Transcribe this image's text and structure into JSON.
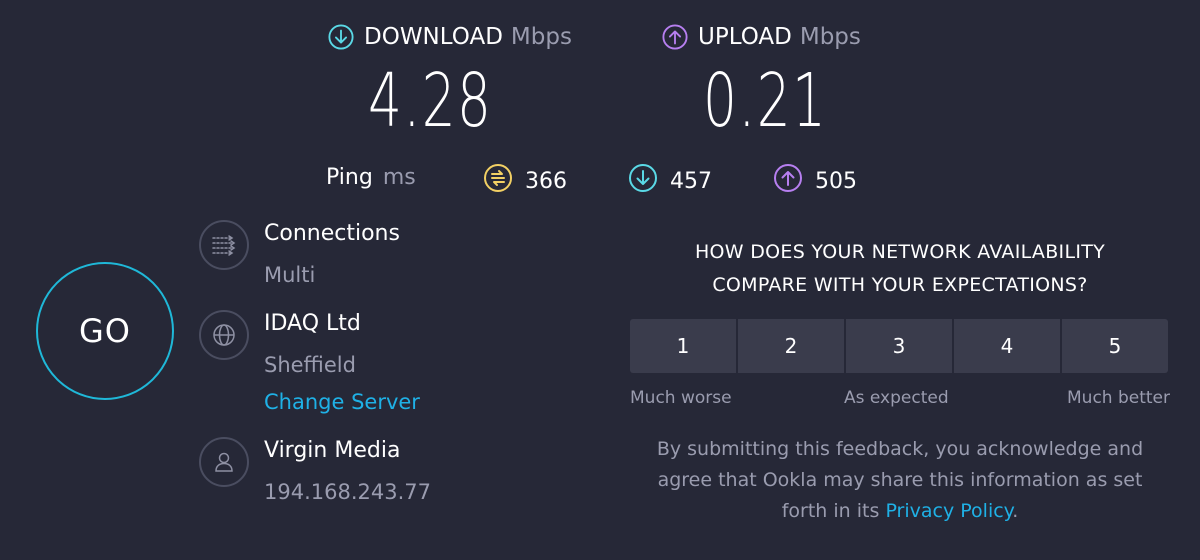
{
  "download": {
    "label": "DOWNLOAD",
    "unit": "Mbps",
    "value": "4.28",
    "icon": "download-arrow-icon",
    "color": "#5ad9e6"
  },
  "upload": {
    "label": "UPLOAD",
    "unit": "Mbps",
    "value": "0.21",
    "icon": "upload-arrow-icon",
    "color": "#b77ff0"
  },
  "ping": {
    "label": "Ping",
    "unit": "ms",
    "idle": "366",
    "download": "457",
    "upload": "505",
    "idle_color": "#f2d064"
  },
  "go_label": "GO",
  "connections": {
    "title": "Connections",
    "value": "Multi"
  },
  "server": {
    "name": "IDAQ Ltd",
    "location": "Sheffield",
    "change_label": "Change Server"
  },
  "provider": {
    "name": "Virgin Media",
    "ip": "194.168.243.77"
  },
  "survey": {
    "question_line1": "HOW DOES YOUR NETWORK AVAILABILITY",
    "question_line2": "COMPARE WITH YOUR EXPECTATIONS?",
    "options": [
      "1",
      "2",
      "3",
      "4",
      "5"
    ],
    "scale_low": "Much worse",
    "scale_mid": "As expected",
    "scale_high": "Much better"
  },
  "disclaimer": {
    "line1": "By submitting this feedback, you acknowledge and",
    "line2": "agree that Ookla may share this information as set",
    "line3_prefix": "forth in its",
    "link": "Privacy Policy",
    "line3_suffix": "."
  }
}
